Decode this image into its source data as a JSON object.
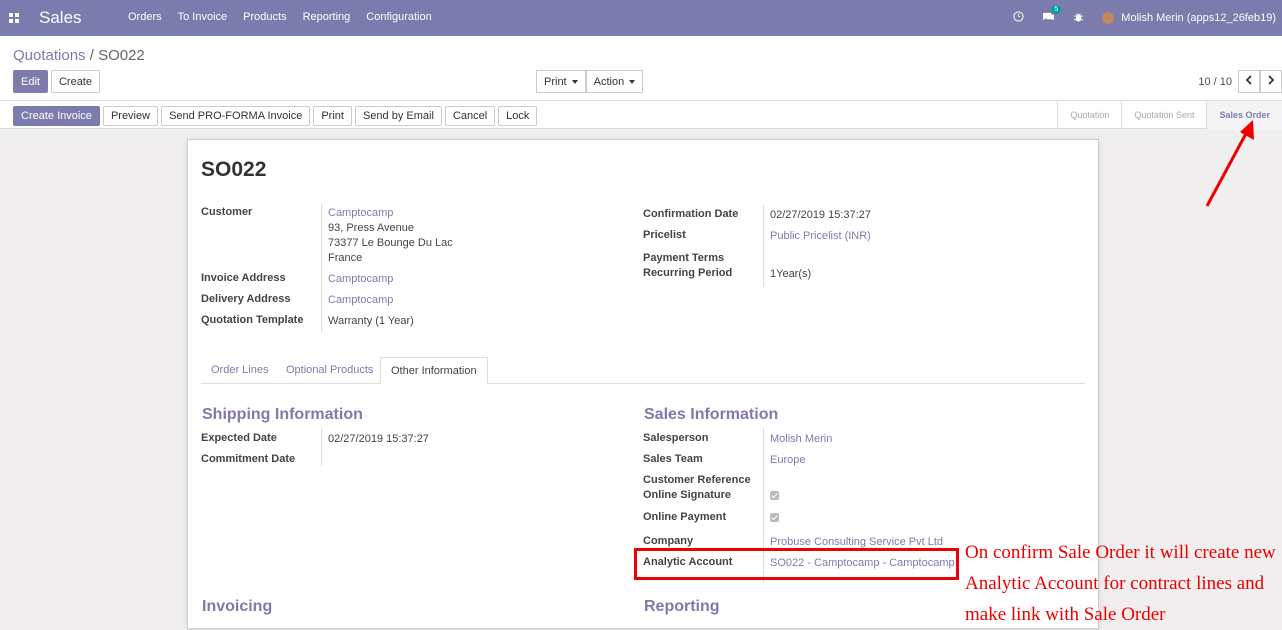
{
  "topbar": {
    "app_title": "Sales",
    "menu": [
      "Orders",
      "To Invoice",
      "Products",
      "Reporting",
      "Configuration"
    ],
    "messages_badge": "5",
    "user": "Molish Merin (apps12_26feb19)"
  },
  "breadcrumb": {
    "parent": "Quotations",
    "separator": "/",
    "current": "SO022"
  },
  "controls": {
    "edit": "Edit",
    "create": "Create",
    "print": "Print",
    "action": "Action",
    "pager": "10 / 10"
  },
  "status_buttons": [
    "Create Invoice",
    "Preview",
    "Send PRO-FORMA Invoice",
    "Print",
    "Send by Email",
    "Cancel",
    "Lock"
  ],
  "stages": [
    "Quotation",
    "Quotation Sent",
    "Sales Order"
  ],
  "sheet": {
    "title": "SO022",
    "left_fields": {
      "customer_label": "Customer",
      "customer_name": "Camptocamp",
      "customer_address": [
        "93, Press Avenue",
        "73377 Le Bounge Du Lac",
        "France"
      ],
      "invoice_label": "Invoice Address",
      "invoice_value": "Camptocamp",
      "delivery_label": "Delivery Address",
      "delivery_value": "Camptocamp",
      "template_label": "Quotation Template",
      "template_value": "Warranty (1 Year)"
    },
    "right_fields": {
      "confirmation_label": "Confirmation Date",
      "confirmation_value": "02/27/2019 15:37:27",
      "pricelist_label": "Pricelist",
      "pricelist_value": "Public Pricelist (INR)",
      "payment_label": "Payment Terms",
      "recurring_label": "Recurring Period",
      "recurring_value": "1Year(s)"
    },
    "tabs": [
      "Order Lines",
      "Optional Products",
      "Other Information"
    ],
    "shipping": {
      "title": "Shipping Information",
      "expected_label": "Expected Date",
      "expected_value": "02/27/2019 15:37:27",
      "commitment_label": "Commitment Date"
    },
    "sales": {
      "title": "Sales Information",
      "salesperson_label": "Salesperson",
      "salesperson_value": "Molish Merin",
      "team_label": "Sales Team",
      "team_value": "Europe",
      "reference_label": "Customer Reference",
      "signature_label": "Online Signature",
      "payment_label": "Online Payment",
      "company_label": "Company",
      "company_value": "Probuse Consulting Service Pvt Ltd",
      "analytic_label": "Analytic Account",
      "analytic_value": "SO022 - Camptocamp - Camptocamp"
    },
    "invoicing_title": "Invoicing",
    "reporting_title": "Reporting"
  },
  "annotation": "On confirm Sale Order it will create new Analytic Account for contract lines and make link with Sale Order",
  "colors": {
    "brand": "#7c7bad",
    "annotation": "#ee0000"
  }
}
